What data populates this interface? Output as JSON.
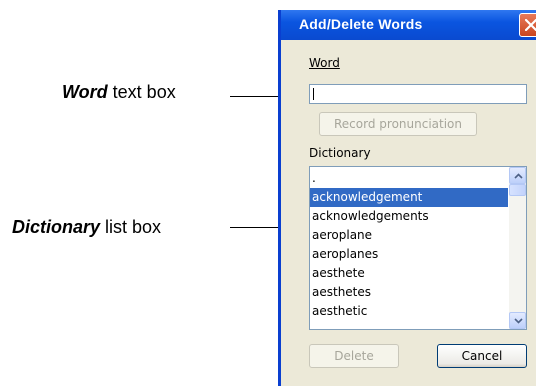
{
  "callouts": {
    "word": {
      "emphasis": "Word",
      "rest": " text box"
    },
    "dictionary": {
      "emphasis": "Dictionary",
      "rest": " list box"
    }
  },
  "dialog": {
    "title": "Add/Delete Words",
    "word_label": "Word",
    "word_value": "",
    "record_button": "Record pronunciation",
    "dictionary_label": "Dictionary",
    "dictionary_items": [
      ".",
      "acknowledgement",
      "acknowledgements",
      "aeroplane",
      "aeroplanes",
      "aesthete",
      "aesthetes",
      "aesthetic"
    ],
    "selected_item": "acknowledgement",
    "delete_button": "Delete",
    "cancel_button": "Cancel"
  }
}
